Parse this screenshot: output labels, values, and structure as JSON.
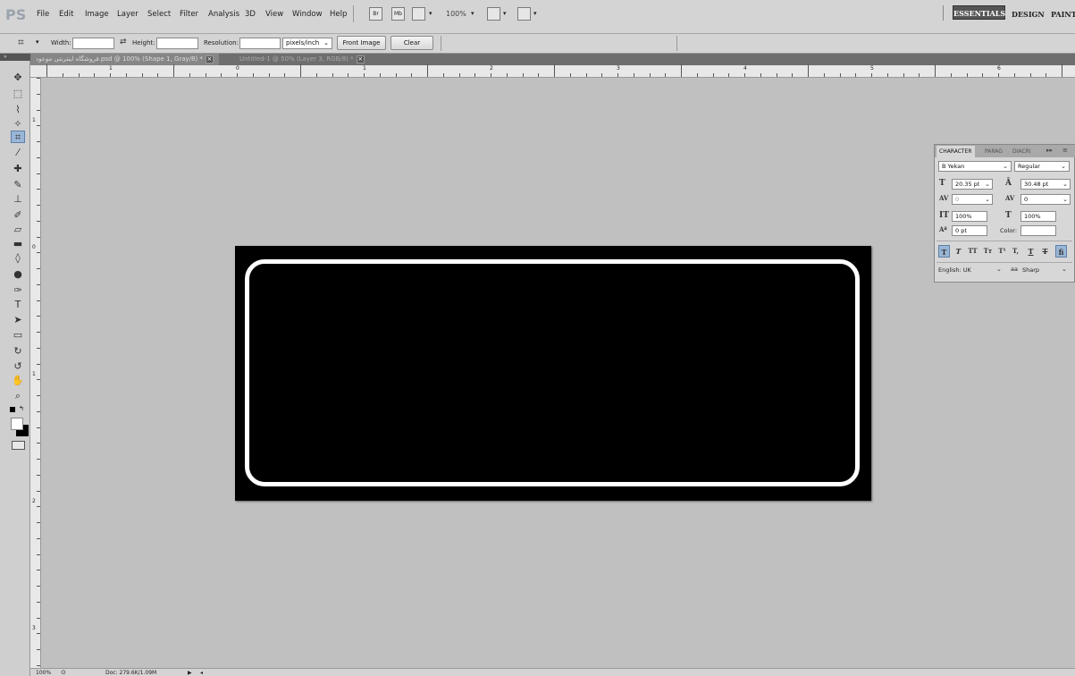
{
  "app": {
    "logo": "PS"
  },
  "menu": [
    "File",
    "Edit",
    "Image",
    "Layer",
    "Select",
    "Filter",
    "Analysis",
    "3D",
    "View",
    "Window",
    "Help"
  ],
  "menubar_icons": {
    "bridge": "Br",
    "mini_bridge": "Mb",
    "zoom": "100%"
  },
  "workspaces": {
    "essentials": "ESSENTIALS",
    "design": "DESIGN",
    "painting": "PAINT"
  },
  "options": {
    "width_label": "Width:",
    "height_label": "Height:",
    "resolution_label": "Resolution:",
    "units": "pixels/inch",
    "front_image": "Front Image",
    "clear": "Clear"
  },
  "tabs": [
    {
      "label": "فروشگاه اینترنتی موعود.psd @ 100% (Shape 1, Gray/8) *"
    },
    {
      "label": "Untitled-1 @ 50% (Layer 3, RGB/8) *"
    }
  ],
  "ruler": {
    "top": [
      "1",
      "0",
      "1",
      "2",
      "3",
      "4",
      "5",
      "6"
    ],
    "left": [
      "1",
      "0",
      "1",
      "2",
      "3"
    ]
  },
  "character_panel": {
    "tabs": [
      "CHARACTER",
      "PARAG",
      "DIACRI"
    ],
    "font_family": "B Yekan",
    "font_style": "Regular",
    "font_size": "20.35 pt",
    "leading": "30.48 pt",
    "kerning": "0",
    "tracking": "0",
    "vertical_scale": "100%",
    "horizontal_scale": "100%",
    "baseline_shift": "0 pt",
    "color_label": "Color:",
    "language": "English: UK",
    "antialias_icon": "aa",
    "antialias": "Sharp"
  },
  "status": {
    "zoom": "100%",
    "doc": "Doc: 279.6K/1.09M"
  },
  "colors": {
    "canvas": "#000000",
    "shape_stroke": "#ffffff",
    "workspace_bg": "#c0c0c0"
  }
}
